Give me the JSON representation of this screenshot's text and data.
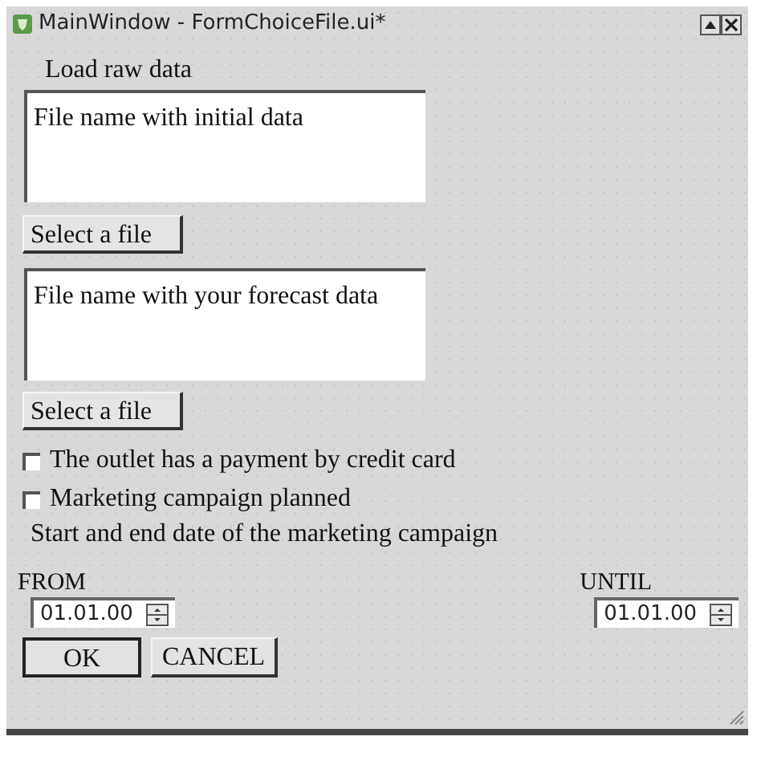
{
  "window": {
    "title": "MainWindow - FormChoiceFile.ui*"
  },
  "raw_data": {
    "label": "Load raw data",
    "text": "File name with initial data",
    "button": "Select a file"
  },
  "forecast_data": {
    "text": "File name with your forecast data",
    "button": "Select a file"
  },
  "options": [
    {
      "label": "The outlet has a payment by credit card",
      "checked": false
    },
    {
      "label": "Marketing campaign planned",
      "checked": false
    }
  ],
  "campaign_label": "Start and end date of the marketing campaign",
  "from": {
    "label": "FROM",
    "value": "01.01.00"
  },
  "until": {
    "label": "UNTIL",
    "value": "01.01.00"
  },
  "buttons": [
    "OK",
    "CANCEL"
  ]
}
